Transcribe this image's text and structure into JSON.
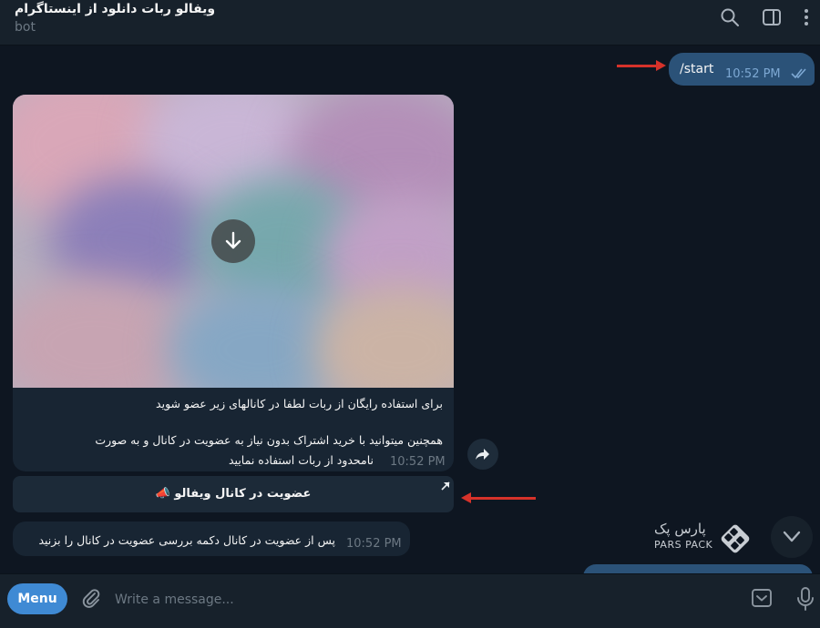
{
  "header": {
    "title": "ویفالو ربات دانلود از اینستاگرام",
    "status": "bot",
    "icons": [
      "search-icon",
      "sidebar-toggle-icon",
      "more-vertical-icon"
    ]
  },
  "messages": {
    "outgoing_start": {
      "text": "/start",
      "time": "10:52 PM",
      "status": "read"
    },
    "media_message": {
      "caption_line1": "برای استفاده رایگان از ربات لطفا در کانالهای زیر عضو شوید",
      "caption_line2": "همچنین میتوانید با خرید اشتراک بدون نیاز به عضویت در کانال و به صورت",
      "caption_line3": "نامحدود از ربات استفاده نمایید",
      "time": "10:52 PM",
      "download_icon": "download-arrow-icon"
    },
    "inline_button": {
      "label": "عضویت در کانال ویفالو",
      "emoji": "📣"
    },
    "incoming_2": {
      "text": "پس از عضویت در کانال دکمه بررسی عضویت در کانال را بزنید",
      "time": "10:52 PM"
    }
  },
  "watermark": {
    "line1": "پارس پک",
    "line2": "PARS PACK"
  },
  "composer": {
    "menu_label": "Menu",
    "placeholder": "Write a message..."
  },
  "colors": {
    "background": "#0e1621",
    "panel": "#17212b",
    "outgoing_bubble": "#2b5278",
    "incoming_bubble": "#182533",
    "accent": "#3f8ad4",
    "annotation_arrow": "#d6322a"
  }
}
